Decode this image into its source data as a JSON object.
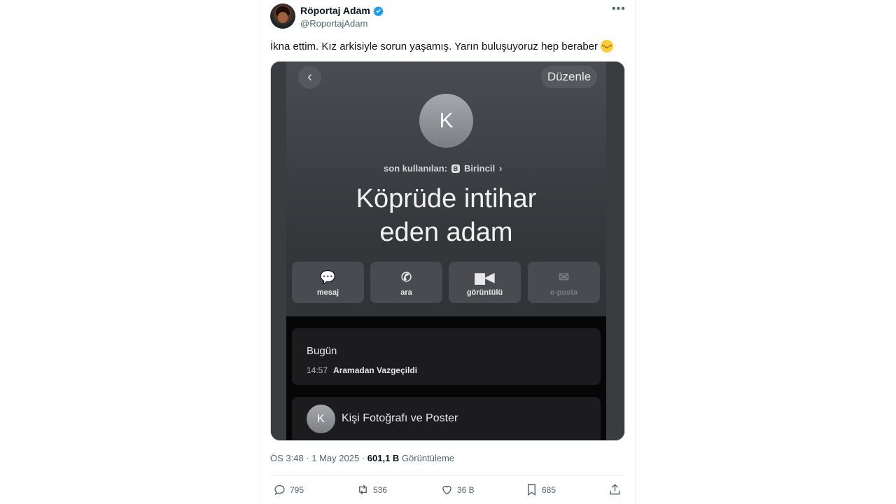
{
  "author": {
    "name": "Röportaj Adam",
    "handle": "@RoportajAdam"
  },
  "tweet": {
    "text": "İkna ettim. Kız arkisiyle sorun yaşamış. Yarın buluşuyoruz hep beraber"
  },
  "screenshot": {
    "edit_label": "Düzenle",
    "avatar_letter": "K",
    "recent_label": "son kullanılan:",
    "recent_chip": "B",
    "recent_value": "Birincil",
    "contact_name_line1": "Köprüde intihar",
    "contact_name_line2": "eden adam",
    "actions": [
      {
        "label": "mesaj",
        "icon": "message-bubble-icon"
      },
      {
        "label": "ara",
        "icon": "phone-icon"
      },
      {
        "label": "görüntülü",
        "icon": "video-icon"
      },
      {
        "label": "e-posta",
        "icon": "mail-icon"
      }
    ],
    "history_title": "Bugün",
    "history_time": "14:57",
    "history_status": "Aramadan Vazgeçildi",
    "poster_letter": "K",
    "poster_label": "Kişi Fotoğrafı ve Poster"
  },
  "meta": {
    "time": "ÖS 3:48",
    "date": "1 May 2025",
    "views_count": "601,1 B",
    "views_label": "Görüntüleme"
  },
  "stats": {
    "replies": "795",
    "reposts": "536",
    "likes": "36 B",
    "bookmarks": "685"
  }
}
